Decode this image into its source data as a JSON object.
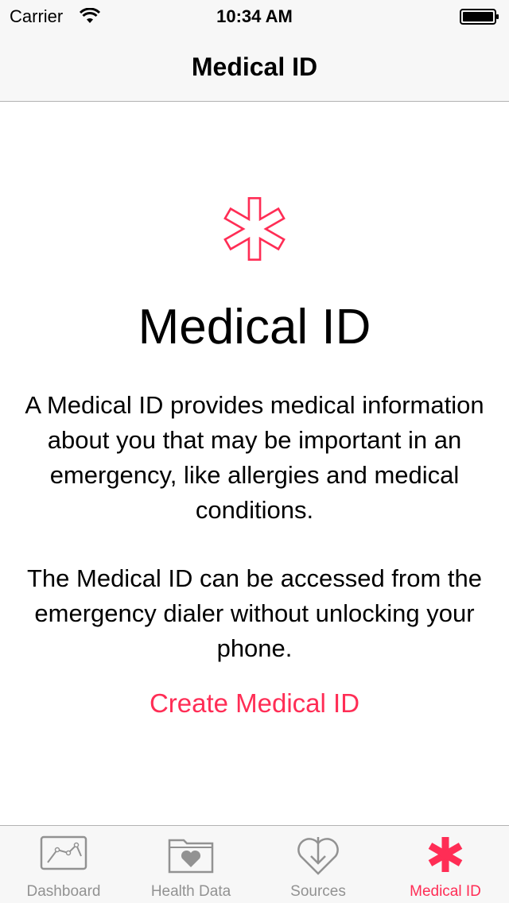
{
  "status_bar": {
    "carrier": "Carrier",
    "time": "10:34 AM",
    "wifi_icon": "wifi-icon",
    "battery_icon": "battery-icon"
  },
  "nav": {
    "title": "Medical ID"
  },
  "content": {
    "icon": "medical-star-icon",
    "title": "Medical ID",
    "paragraph_1": "A Medical ID provides medical information about you that may be important in an emergency, like allergies and medical conditions.",
    "paragraph_2": "The Medical ID can be accessed from the emergency dialer without unlocking your phone.",
    "create_label": "Create Medical ID"
  },
  "tab_bar": {
    "tabs": [
      {
        "label": "Dashboard",
        "icon": "dashboard-chart-icon",
        "active": false
      },
      {
        "label": "Health Data",
        "icon": "health-data-folder-icon",
        "active": false
      },
      {
        "label": "Sources",
        "icon": "sources-heart-download-icon",
        "active": false
      },
      {
        "label": "Medical ID",
        "icon": "medical-star-icon",
        "active": true
      }
    ]
  },
  "colors": {
    "accent": "#ff2d55",
    "inactive_tab": "#929292",
    "bar_background": "#f7f7f7",
    "divider": "#b2b2b2"
  }
}
